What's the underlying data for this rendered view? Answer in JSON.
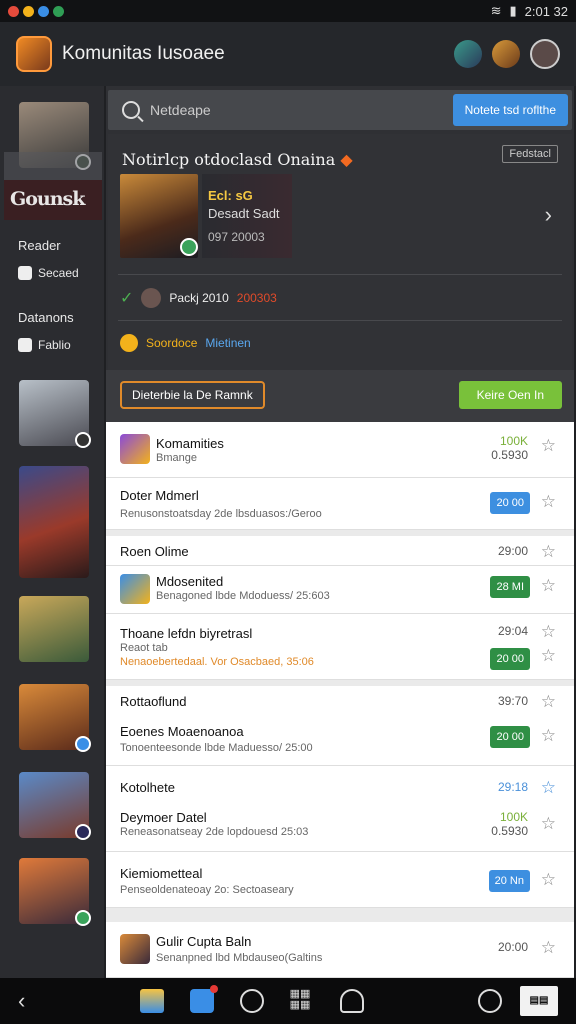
{
  "status": {
    "time": "2:01 32"
  },
  "app": {
    "title": "Komunitas Iusoaee"
  },
  "sidebar": {
    "logo_text": "Gounsk",
    "section1": "Reader",
    "link1": "Secaed",
    "section2": "Datanons",
    "link2": "Fablio",
    "logo2_text": "Gounsk"
  },
  "search": {
    "placeholder": "Netdeape",
    "button": "Notete tsd roflthe"
  },
  "panel": {
    "title": "Notirlcp otdoclasd Onaina",
    "tag": "Fedstacl",
    "featured": {
      "line1": "Ecl: sG",
      "line2": "Desadt Sadt",
      "line3": "097 20003"
    },
    "info1_left": "Packj 2010",
    "info1_right": "200303",
    "info2_left": "Soordoce",
    "info2_right": "Mietinen"
  },
  "actions": {
    "outline_button": "Dieterbie la De Ramnk",
    "green_button": "Keire Oen In"
  },
  "list": [
    {
      "title": "Komamities",
      "sub": "Bmange",
      "value": "100K",
      "value2": "0.5930"
    },
    {
      "title": "Doter Mdmerl",
      "sub": "Renusonstoatsday 2de lbsduasos:/Geroo",
      "pill": "20 00"
    },
    {
      "title": "Roen Olime",
      "value": "29:00"
    },
    {
      "title": "Mdosenited",
      "sub": "Benagoned lbde Mdoduess/ 25:603",
      "pill": "28 MI"
    },
    {
      "title": "Thoane lefdn biyretrasl",
      "sub": "Reaot tab",
      "sub2": "Nenaoebertedaal. Vor Osacbaed, 35:06",
      "value": "29:04",
      "pill": "20 00"
    },
    {
      "title": "Rottaoflund",
      "value": "39:70"
    },
    {
      "title": "Eoenes Moaenoanoa",
      "sub": "Tonoenteesonde lbde Maduesso/ 25:00",
      "pill": "20 00"
    },
    {
      "title": "Kotolhete",
      "value": "29:18"
    },
    {
      "title": "Deymoer Datel",
      "sub": "Reneasonatseay 2de lopdouesd 25:03",
      "value": "100K",
      "value2": "0.5930"
    },
    {
      "title": "Kiemiometteal",
      "sub": "Penseoldenateoay 2o: Sectoaseary",
      "pill": "20 Nn"
    },
    {
      "title": "Gulir Cupta Baln",
      "sub": "Senanpned lbd Mbdauseo(Galtins",
      "value": "20:00"
    }
  ]
}
